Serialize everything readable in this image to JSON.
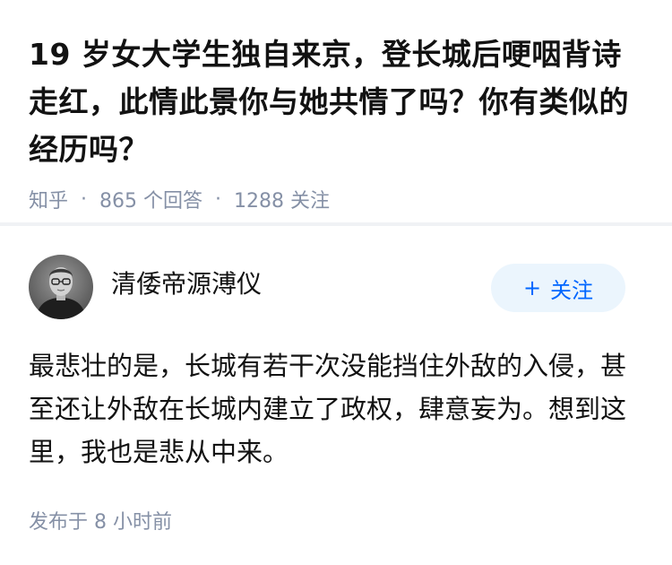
{
  "question": {
    "title": "19 岁女大学生独自来京，登长城后哽咽背诗走红，此情此景你与她共情了吗？你有类似的经历吗？",
    "meta": {
      "source": "知乎",
      "answers": "865 个回答",
      "followers": "1288 关注",
      "separator": "·"
    }
  },
  "answer": {
    "author": {
      "name": "清倭帝源溥仪",
      "avatar_icon": "portrait-avatar"
    },
    "follow_button": {
      "plus": "+",
      "label": "关注"
    },
    "content": "最悲壮的是，长城有若干次没能挡住外敌的入侵，甚至还让外敌在长城内建立了政权，肆意妄为。想到这里，我也是悲从中来。",
    "published": "发布于 8 小时前"
  },
  "colors": {
    "meta_gray": "#8590a6",
    "brand_blue": "#0066ff",
    "follow_bg": "#ebf5fd",
    "divider": "#f0f2f5"
  }
}
